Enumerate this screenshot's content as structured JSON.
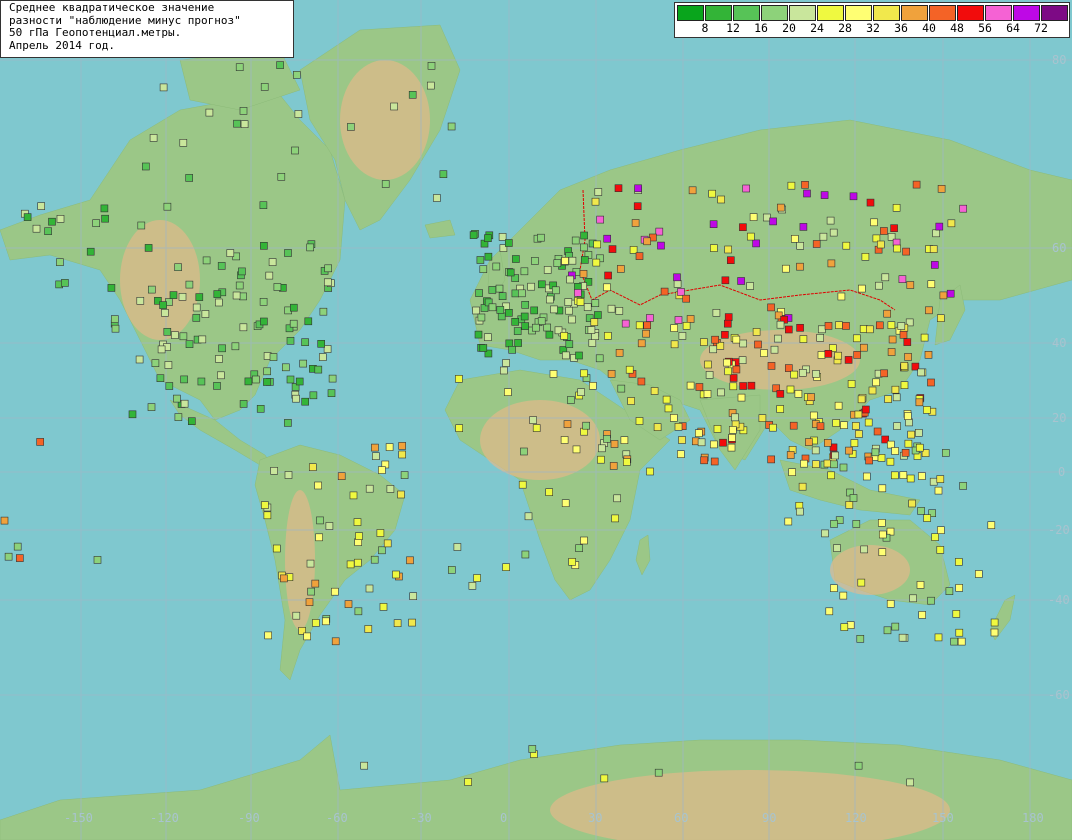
{
  "title": {
    "lines": [
      "Среднее квадратическое значение",
      "разности \"наблюдение минус прогноз\"",
      "50 гПа Геопотенциал.метры.",
      "Апрель 2014 год."
    ]
  },
  "legend": {
    "colors": [
      "#09a51c",
      "#33b437",
      "#57c357",
      "#8dd27a",
      "#c9e69c",
      "#eff940",
      "#ffff73",
      "#f1e84c",
      "#f0a23c",
      "#f46326",
      "#f20c0c",
      "#f562d4",
      "#be08e6",
      "#7d0a85"
    ],
    "labels": [
      "8",
      "12",
      "16",
      "20",
      "24",
      "28",
      "32",
      "36",
      "40",
      "48",
      "56",
      "64",
      "72"
    ]
  },
  "axes": {
    "lon_labels": [
      "-150",
      "-120",
      "-90",
      "-60",
      "-30",
      "0",
      "30",
      "60",
      "90",
      "120",
      "150",
      "180"
    ],
    "lat_labels": [
      "80",
      "60",
      "40",
      "20",
      "0",
      "-20",
      "-40",
      "-60"
    ]
  }
}
